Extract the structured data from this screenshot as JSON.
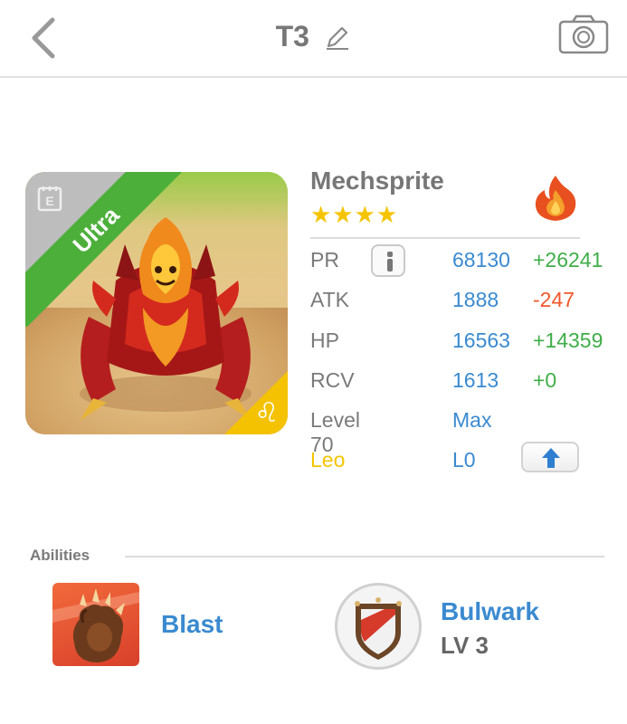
{
  "header": {
    "title": "T3",
    "back_icon": "chevron-left-icon",
    "edit_icon": "pencil-icon",
    "camera_icon": "camera-icon"
  },
  "monster": {
    "name": "Mechsprite",
    "rarity_label": "Ultra",
    "stars": "★★★★",
    "star_count": 4,
    "element_icon": "fire-icon",
    "zodiac_glyph": "♌"
  },
  "stats": {
    "pr": {
      "label": "PR",
      "value": "68130",
      "diff": "+26241"
    },
    "atk": {
      "label": "ATK",
      "value": "1888",
      "diff": "-247"
    },
    "hp": {
      "label": "HP",
      "value": "16563",
      "diff": "+14359"
    },
    "rcv": {
      "label": "RCV",
      "value": "1613",
      "diff": "+0"
    },
    "level": {
      "label": "Level 70",
      "value": "Max"
    },
    "zodiac": {
      "label": "Leo",
      "value": "L0"
    }
  },
  "abilities": {
    "title": "Abilities",
    "items": [
      {
        "name": "Blast",
        "icon": "claw-icon"
      },
      {
        "name": "Bulwark",
        "level": "LV 3",
        "icon": "shield-icon"
      }
    ]
  },
  "colors": {
    "accent_blue": "#3a8ad0",
    "positive": "#3fae49",
    "negative": "#f0592a",
    "zodiac_yellow": "#f5c400",
    "ribbon_green": "#4caf3a"
  }
}
